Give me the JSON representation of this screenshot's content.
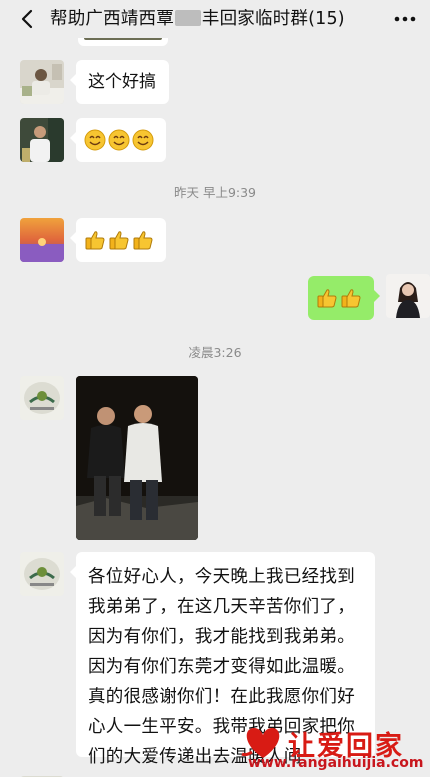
{
  "header": {
    "title_part1": "帮助广西靖西覃",
    "title_part2": "丰回家临时群(15)",
    "back_icon": "chevron-left-icon",
    "more_icon": "ellipsis-icon"
  },
  "messages": [
    {
      "side": "left",
      "type": "text",
      "text": "这个好搞"
    },
    {
      "side": "left",
      "type": "emoji",
      "emoji": "smile",
      "count": 3
    },
    {
      "type": "time",
      "text": "昨天 早上9:39"
    },
    {
      "side": "left",
      "type": "emoji",
      "emoji": "thumbs-up",
      "count": 3
    },
    {
      "side": "right",
      "type": "emoji",
      "emoji": "thumbs-up",
      "count": 2
    },
    {
      "type": "time",
      "text": "凌晨3:26"
    },
    {
      "side": "left",
      "type": "image"
    },
    {
      "side": "left",
      "type": "text",
      "lines": [
        "各位好心人，今天晚上我已经找到",
        "我弟弟了，在这几天辛苦你们了，",
        "因为有你们，我才能找到我弟弟。",
        "因为有你们东莞才变得如此温暖。",
        "真的很感谢你们！在此我愿你们好",
        "心人一生平安。我带我弟回家把你",
        "们的大爱传递出去温暖人间"
      ]
    }
  ],
  "watermark": {
    "brand": "让爱回家",
    "url": "www.rangaihuijia.com",
    "color": "#d81b14"
  },
  "colors": {
    "background": "#ededed",
    "self_bubble": "#95ec69",
    "other_bubble": "#ffffff"
  }
}
